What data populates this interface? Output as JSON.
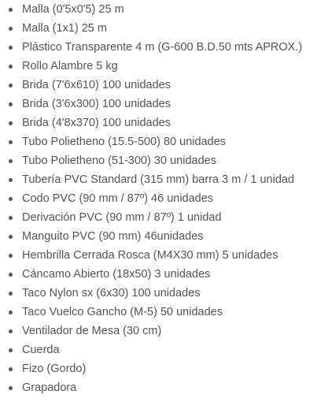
{
  "items": [
    "Malla (0'5x0'5) 25 m",
    "Malla (1x1) 25 m",
    "Plástico Transparente 4 m (G-600 B.D.50 mts APROX.)",
    "Rollo Alambre 5 kg",
    "Brida (7'6x610) 100 unidades",
    "Brida (3'6x300) 100 unidades",
    "Brida (4'8x370) 100 unidades",
    "Tubo Polietheno (15.5-500) 80 unidades",
    "Tubo Polietheno (51-300) 30 unidades",
    "Tubería PVC Standard (315 mm) barra 3 m / 1 unidad",
    "Codo PVC (90 mm / 87º) 46 unidades",
    "Derivación PVC (90 mm / 87º) 1 unidad",
    "Manguito PVC (90 mm) 46unidades",
    "Hembrilla Cerrada Rosca (M4X30 mm) 5 unidades",
    "Cáncamo Abierto (18x50) 3 unidades",
    "Taco Nylon sx (6x30) 100 unidades",
    "Taco Vuelco Gancho (M-5) 50 unidades",
    "Ventilador de Mesa (30 cm)",
    "Cuerda",
    "Fizo (Gordo)",
    "Grapadora"
  ],
  "bullet_icon": "disc-bullet",
  "text_color": "#555555"
}
